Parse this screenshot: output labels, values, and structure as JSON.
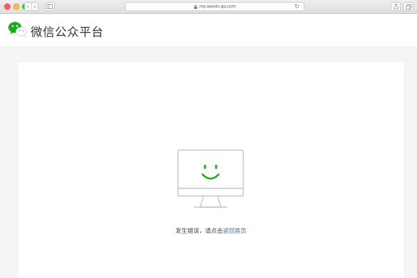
{
  "browser": {
    "url": "mp.weixin.qq.com",
    "back_glyph": "‹",
    "forward_glyph": "›",
    "reload_glyph": "↻"
  },
  "header": {
    "logo_text": "微信公众平台",
    "logo_icon": "wechat-logo-icon"
  },
  "error": {
    "message": "发生错误，请点击",
    "link_text": "返回首页",
    "illustration": "smiling-monitor-icon"
  },
  "colors": {
    "brand_green": "#1aad19",
    "link_blue": "#576b95"
  }
}
